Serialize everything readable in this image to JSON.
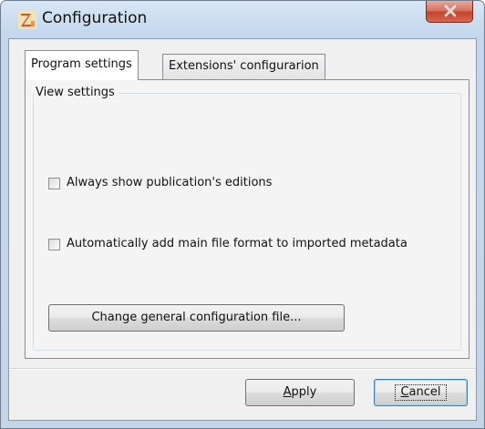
{
  "window": {
    "title": "Configuration",
    "app_icon": "app-icon",
    "close_icon": "close-icon",
    "close_color": "#c4432a"
  },
  "tabs": [
    {
      "label": "Program settings",
      "active": true
    },
    {
      "label": "Extensions' configurarion",
      "active": false
    }
  ],
  "view_settings": {
    "legend": "View settings",
    "options": [
      {
        "label": "Always show publication's editions",
        "checked": false
      },
      {
        "label": "Automatically add main file format to imported metadata",
        "checked": false
      }
    ],
    "change_config_label": "Change general configuration file..."
  },
  "buttons": {
    "apply": {
      "accel": "A",
      "rest": "pply"
    },
    "cancel": {
      "accel": "C",
      "rest": "ancel"
    }
  }
}
